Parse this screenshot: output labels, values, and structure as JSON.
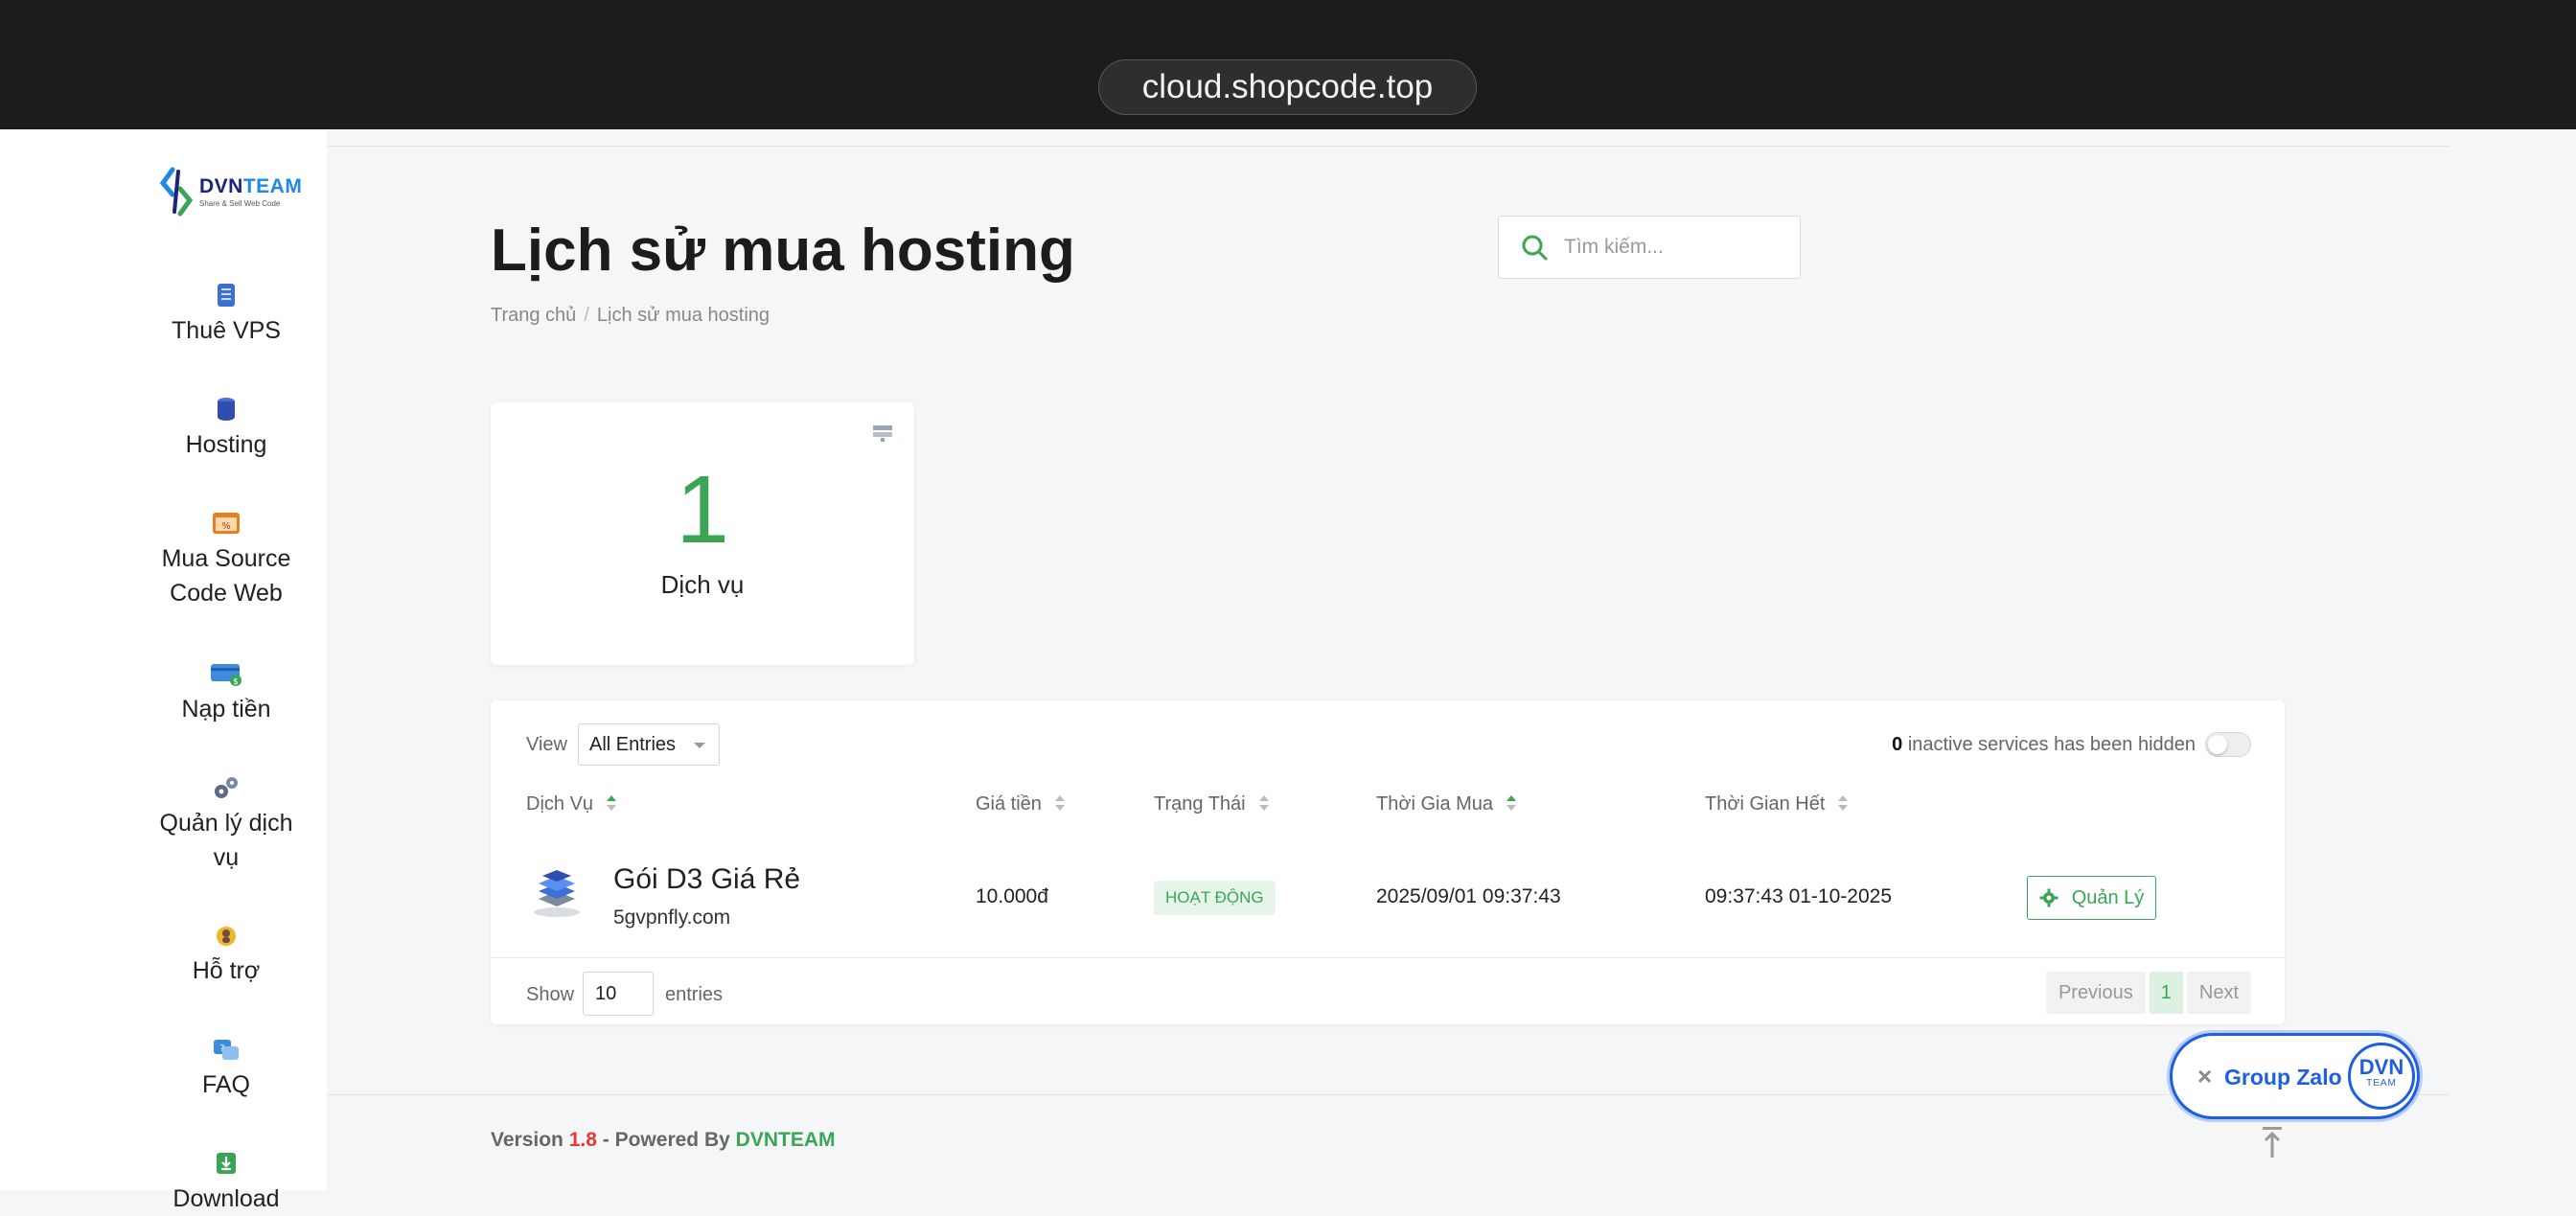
{
  "browser": {
    "url": "cloud.shopcode.top"
  },
  "logo": {
    "name_a": "DVN",
    "name_b": "TEAM",
    "tagline": "Share & Sell Web Code"
  },
  "sidebar": {
    "items": [
      {
        "label": "Thuê VPS",
        "icon": "server-icon",
        "color": "#3d6fd8"
      },
      {
        "label": "Hosting",
        "icon": "database-icon",
        "color": "#2f4fb0"
      },
      {
        "label": "Mua Source Code Web",
        "icon": "code-window-icon",
        "color": "#e67e22"
      },
      {
        "label": "Nạp tiền",
        "icon": "wallet-card-icon",
        "color": "#3d8be0"
      },
      {
        "label": "Quản lý dịch vụ",
        "icon": "gears-icon",
        "color": "#5b6b85"
      },
      {
        "label": "Hỗ trợ",
        "icon": "support-icon",
        "color": "#f0b429"
      },
      {
        "label": "FAQ",
        "icon": "faq-icon",
        "color": "#3d8be0"
      },
      {
        "label": "Download",
        "icon": "download-icon",
        "color": "#3aa655"
      }
    ]
  },
  "header": {
    "title": "Lịch sử mua hosting",
    "breadcrumb": [
      "Trang chủ",
      "Lịch sử mua hosting"
    ],
    "search_placeholder": "Tìm kiếm..."
  },
  "stat": {
    "value": "1",
    "label": "Dịch vụ",
    "icon": "server-rack-icon"
  },
  "table": {
    "view_label": "View",
    "view_value": "All Entries",
    "hidden_count": "0",
    "hidden_text": "inactive services has been hidden",
    "toggle_on": false,
    "columns": [
      "Dịch Vụ",
      "Giá tiền",
      "Trạng Thái",
      "Thời Gia Mua",
      "Thời Gian Hết"
    ],
    "rows": [
      {
        "name": "Gói D3 Giá Rẻ",
        "domain": "5gvpnfly.com",
        "price": "10.000đ",
        "status": "HOẠT ĐỘNG",
        "bought": "2025/09/01 09:37:43",
        "expires": "09:37:43 01-10-2025",
        "action": "Quản Lý"
      }
    ],
    "show_label": "Show",
    "show_value": "10",
    "entries_label": "entries",
    "pager": {
      "prev": "Previous",
      "current": "1",
      "next": "Next"
    }
  },
  "footer": {
    "version_label": "Version",
    "version": "1.8",
    "powered": "- Powered By",
    "brand": "DVNTEAM"
  },
  "zalo": {
    "close": "×",
    "label": "Group Zalo",
    "avatar_top": "DVN",
    "avatar_bottom": "TEAM"
  },
  "colors": {
    "accent": "#3aa655",
    "zalo": "#1d5fe0",
    "version": "#e53935"
  }
}
